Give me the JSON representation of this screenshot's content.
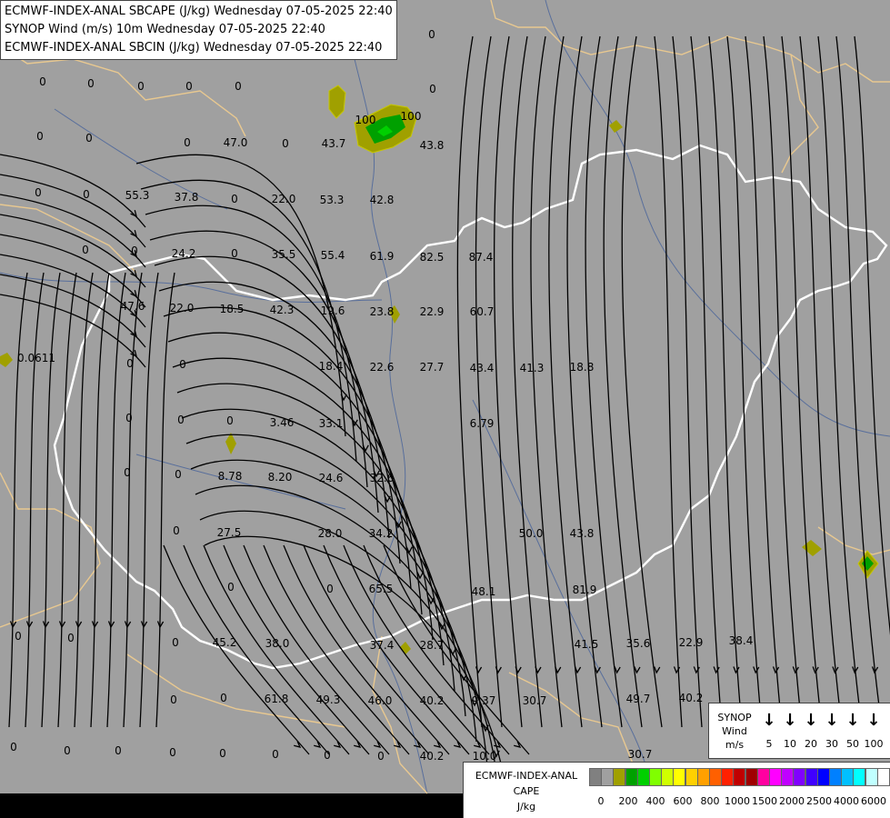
{
  "titles": [
    "ECMWF-INDEX-ANAL SBCAPE (J/kg) Wednesday 07-05-2025 22:40",
    "SYNOP Wind (m/s) 10m Wednesday 07-05-2025 22:40",
    "ECMWF-INDEX-ANAL SBCIN (J/kg) Wednesday 07-05-2025 22:40"
  ],
  "colors": {
    "background": "#a0a0a0",
    "border_country": "#ffffff",
    "border_outer": "#e8c890",
    "river": "#3a5a9a",
    "streamline": "#000000"
  },
  "wind_legend": {
    "label_lines": [
      "SYNOP",
      "Wind",
      "m/s"
    ],
    "speeds": [
      "5",
      "10",
      "20",
      "30",
      "50",
      "100"
    ],
    "arrow_icon": "down-arrow-icon"
  },
  "cape_legend": {
    "label_lines": [
      "ECMWF-INDEX-ANAL",
      "CAPE",
      "J/kg"
    ],
    "swatch_colors": [
      "#808080",
      "#a0a0a0",
      "#a0a000",
      "#00a000",
      "#00d000",
      "#80ff00",
      "#d0ff00",
      "#ffff00",
      "#ffd000",
      "#ffa000",
      "#ff6000",
      "#ff2000",
      "#c00000",
      "#a00000",
      "#ff00a0",
      "#ff00ff",
      "#c000ff",
      "#8000ff",
      "#4000ff",
      "#0000ff",
      "#0080ff",
      "#00c0ff",
      "#00ffff",
      "#c0ffff",
      "#ffffff"
    ],
    "ticks": [
      "0",
      "200",
      "400",
      "600",
      "800",
      "1000",
      "1500",
      "2000",
      "2500",
      "4000",
      "6000"
    ]
  },
  "values": [
    "0",
    "0",
    "0",
    "0",
    "0",
    "0",
    "0",
    "0",
    "0",
    "0",
    "0",
    "0",
    "0",
    "0",
    "0",
    "0",
    "0",
    "0",
    "0",
    "0",
    "0",
    "0",
    "0",
    "0",
    "0",
    "0",
    "0",
    "0",
    "0",
    "0",
    "0",
    "0",
    "0",
    "0",
    "0",
    "0",
    "0",
    "0",
    "0",
    "0",
    "47.0",
    "43.7",
    "43.8",
    "55.3",
    "37.8",
    "22.0",
    "53.3",
    "42.8",
    "24.2",
    "35.5",
    "55.4",
    "61.9",
    "82.5",
    "87.4",
    "47.6",
    "22.0",
    "18.5",
    "42.3",
    "19.6",
    "23.8",
    "22.9",
    "60.7",
    "0.0611",
    "18.4",
    "22.6",
    "27.7",
    "43.4",
    "41.3",
    "18.8",
    "3.46",
    "33.1",
    "6.79",
    "8.78",
    "8.20",
    "24.6",
    "32.6",
    "27.5",
    "28.0",
    "34.2",
    "50.0",
    "43.8",
    "65.5",
    "48.1",
    "81.9",
    "45.2",
    "38.0",
    "37.4",
    "28.7",
    "41.5",
    "35.6",
    "22.9",
    "38.4",
    "61.8",
    "49.3",
    "46.0",
    "40.2",
    "9.37",
    "30.7",
    "49.7",
    "40.2",
    "40.2",
    "10.0",
    "30.7",
    "100",
    "100"
  ]
}
